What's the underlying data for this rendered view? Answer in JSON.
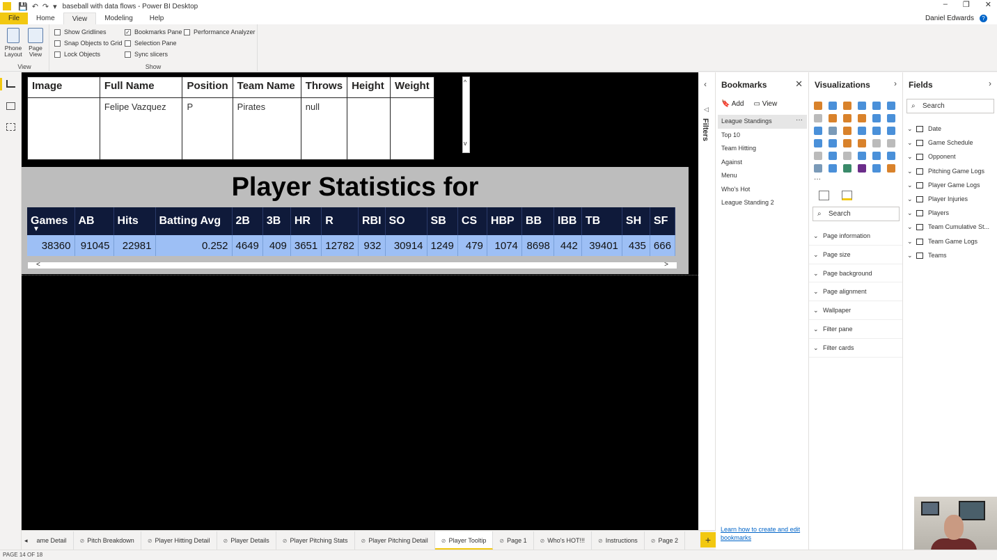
{
  "window": {
    "title": "baseball with data flows - Power BI Desktop",
    "controls": [
      "–",
      "❐",
      "✕"
    ]
  },
  "ribbon_tabs": [
    "File",
    "Home",
    "View",
    "Modeling",
    "Help"
  ],
  "user_name": "Daniel Edwards",
  "ribbon": {
    "view_group": {
      "label": "View",
      "phone_layout": "Phone Layout",
      "page_view": "Page View"
    },
    "show_group": {
      "label": "Show",
      "show_gridlines": {
        "label": "Show Gridlines",
        "checked": false
      },
      "snap_objects": {
        "label": "Snap Objects to Grid",
        "checked": false
      },
      "lock_objects": {
        "label": "Lock Objects",
        "checked": false
      },
      "bookmarks_pane": {
        "label": "Bookmarks Pane",
        "checked": true
      },
      "selection_pane": {
        "label": "Selection Pane",
        "checked": false
      },
      "sync_slicers": {
        "label": "Sync slicers",
        "checked": false
      },
      "performance_analyzer": {
        "label": "Performance Analyzer",
        "checked": false
      }
    }
  },
  "detail_table": {
    "headers": [
      "Image",
      "Full Name",
      "Position",
      "Team Name",
      "Throws",
      "Height",
      "Weight"
    ],
    "row": [
      "",
      "Felipe Vazquez",
      "P",
      "Pirates",
      "null",
      "",
      ""
    ]
  },
  "stats": {
    "title": "Player Statistics for",
    "headers": [
      "Games",
      "AB",
      "Hits",
      "Batting Avg",
      "2B",
      "3B",
      "HR",
      "R",
      "RBI",
      "SO",
      "SB",
      "CS",
      "HBP",
      "BB",
      "IBB",
      "TB",
      "SH",
      "SF"
    ],
    "values": [
      "38360",
      "91045",
      "22981",
      "0.252",
      "4649",
      "409",
      "3651",
      "12782",
      "932",
      "30914",
      "1249",
      "479",
      "1074",
      "8698",
      "442",
      "39401",
      "435",
      "666"
    ]
  },
  "filters_label": "Filters",
  "bookmarks": {
    "title": "Bookmarks",
    "add": "Add",
    "view": "View",
    "items": [
      "League Standings",
      "Top 10",
      "Team Hitting",
      "Against",
      "Menu",
      "Who's Hot",
      "League Standing 2"
    ],
    "selected": "League Standings",
    "help_link": "Learn how to create and edit bookmarks"
  },
  "visualizations": {
    "title": "Visualizations",
    "search_placeholder": "Search",
    "format_sections": [
      "Page information",
      "Page size",
      "Page background",
      "Page alignment",
      "Wallpaper",
      "Filter pane",
      "Filter cards"
    ]
  },
  "fields": {
    "title": "Fields",
    "search_placeholder": "Search",
    "tables": [
      "Date",
      "Game Schedule",
      "Opponent",
      "Pitching Game Logs",
      "Player Game Logs",
      "Player Injuries",
      "Players",
      "Team Cumulative St...",
      "Team Game Logs",
      "Teams"
    ]
  },
  "page_tabs": [
    "ame Detail",
    "Pitch Breakdown",
    "Player Hitting Detail",
    "Player Details",
    "Player Pitching Stats",
    "Player Pitching Detail",
    "Player Tooltip",
    "Page 1",
    "Who's HOT!!!",
    "Instructions",
    "Page 2"
  ],
  "active_page_tab": "Player Tooltip",
  "status": "PAGE 14 OF 18",
  "colors": {
    "accent": "#f2c811",
    "header_navy": "#0f1a3a",
    "row_blue": "#9dbff5",
    "band_gray": "#bdbdbd"
  }
}
